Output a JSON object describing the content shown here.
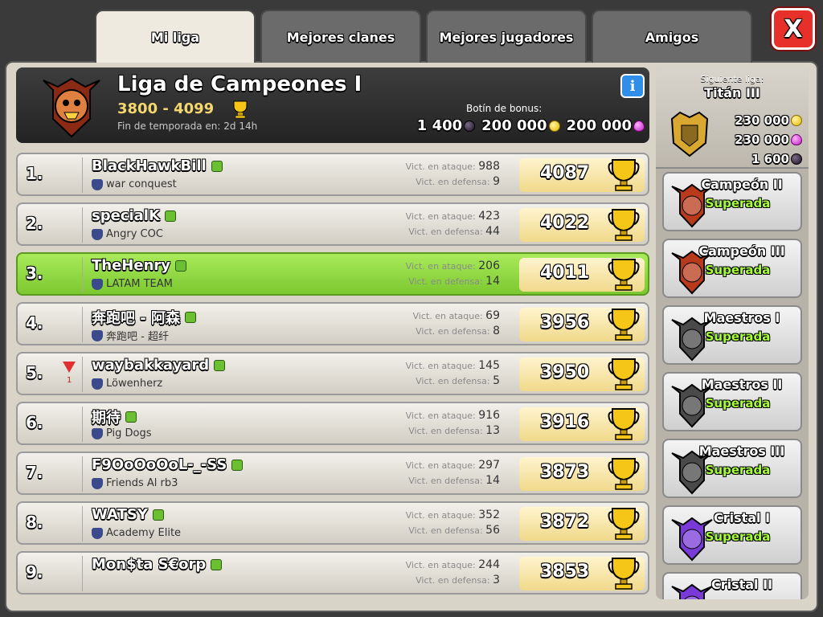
{
  "tabs": [
    {
      "label": "Mi liga",
      "active": true
    },
    {
      "label": "Mejores clanes",
      "active": false
    },
    {
      "label": "Mejores jugadores",
      "active": false
    },
    {
      "label": "Amigos",
      "active": false
    }
  ],
  "close_label": "X",
  "league": {
    "title": "Liga de Campeones I",
    "range": "3800 - 4099",
    "season_end": "Fin de temporada en: 2d 14h",
    "info_label": "i",
    "bonus_label": "Botín de bonus:",
    "bonus_dark": "1 400",
    "bonus_gold": "200 000",
    "bonus_elixir": "200 000"
  },
  "players": [
    {
      "rank": "1.",
      "name": "BlackHawkBill",
      "clan": "war conquest",
      "attack_label": "Vict. en ataque:",
      "attack": "988",
      "defense_label": "Vict. en defensa:",
      "defense": "9",
      "trophies": "4087",
      "highlight": false,
      "demote": ""
    },
    {
      "rank": "2.",
      "name": "specialK",
      "clan": "Angry COC",
      "attack_label": "Vict. en ataque:",
      "attack": "423",
      "defense_label": "Vict. en defensa:",
      "defense": "44",
      "trophies": "4022",
      "highlight": false,
      "demote": ""
    },
    {
      "rank": "3.",
      "name": "TheHenry",
      "clan": "LATAM TEAM",
      "attack_label": "Vict. en ataque:",
      "attack": "206",
      "defense_label": "Vict. en defensa:",
      "defense": "14",
      "trophies": "4011",
      "highlight": true,
      "demote": ""
    },
    {
      "rank": "4.",
      "name": "奔跑吧 - 阿森",
      "clan": "奔跑吧 - 超纤",
      "attack_label": "Vict. en ataque:",
      "attack": "69",
      "defense_label": "Vict. en defensa:",
      "defense": "8",
      "trophies": "3956",
      "highlight": false,
      "demote": ""
    },
    {
      "rank": "5.",
      "name": "waybakkayard",
      "clan": "Löwenherz",
      "attack_label": "Vict. en ataque:",
      "attack": "145",
      "defense_label": "Vict. en defensa:",
      "defense": "5",
      "trophies": "3950",
      "highlight": false,
      "demote": "1"
    },
    {
      "rank": "6.",
      "name": "期待",
      "clan": "Pig Dogs",
      "attack_label": "Vict. en ataque:",
      "attack": "916",
      "defense_label": "Vict. en defensa:",
      "defense": "13",
      "trophies": "3916",
      "highlight": false,
      "demote": ""
    },
    {
      "rank": "7.",
      "name": "F9OoOoOoL-_-SS",
      "clan": "Friends Al rb3",
      "attack_label": "Vict. en ataque:",
      "attack": "297",
      "defense_label": "Vict. en defensa:",
      "defense": "14",
      "trophies": "3873",
      "highlight": false,
      "demote": ""
    },
    {
      "rank": "8.",
      "name": "WATSY",
      "clan": "Academy Elite",
      "attack_label": "Vict. en ataque:",
      "attack": "352",
      "defense_label": "Vict. en defensa:",
      "defense": "56",
      "trophies": "3872",
      "highlight": false,
      "demote": ""
    },
    {
      "rank": "9.",
      "name": "Mon$ta S€orp",
      "clan": "",
      "attack_label": "Vict. en ataque:",
      "attack": "244",
      "defense_label": "Vict. en defensa:",
      "defense": "3",
      "trophies": "3853",
      "highlight": false,
      "demote": ""
    }
  ],
  "next_league": {
    "label": "Siguiente liga:",
    "name": "Titán III",
    "reward_gold": "230 000",
    "reward_elixir": "230 000",
    "reward_dark": "1 600"
  },
  "leagues": [
    {
      "name": "Campeón II",
      "status": "Superada",
      "color": "#b83a1a"
    },
    {
      "name": "Campeón III",
      "status": "Superada",
      "color": "#b83a1a"
    },
    {
      "name": "Maestros I",
      "status": "Superada",
      "color": "#4a4a4a"
    },
    {
      "name": "Maestros II",
      "status": "Superada",
      "color": "#4a4a4a"
    },
    {
      "name": "Maestros III",
      "status": "Superada",
      "color": "#4a4a4a"
    },
    {
      "name": "Cristal I",
      "status": "Superada",
      "color": "#7a3ad8"
    },
    {
      "name": "Cristal II",
      "status": "",
      "color": "#7a3ad8"
    }
  ]
}
